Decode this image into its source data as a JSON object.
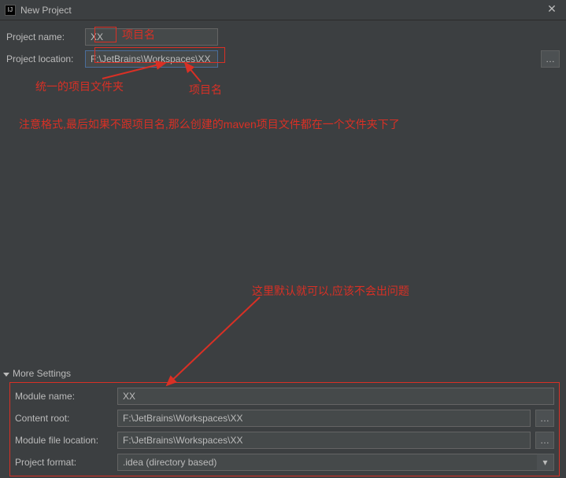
{
  "window": {
    "title": "New Project"
  },
  "form": {
    "project_name_label": "Project name:",
    "project_name_value": "XX",
    "project_location_label": "Project location:",
    "project_location_value": "F:\\JetBrains\\Workspaces\\XX",
    "browse_dots": "…"
  },
  "annotations": {
    "name1": "项目名",
    "unified": "统一的项目文件夹",
    "name2": "项目名",
    "warning": "注意格式,最后如果不跟项目名,那么创建的maven项目文件都在一个文件夹下了",
    "default_ok": "这里默认就可以,应该不会出问题"
  },
  "more": {
    "header": "More Settings",
    "module_name_label": "Module name:",
    "module_name_value": "XX",
    "content_root_label": "Content root:",
    "content_root_value": "F:\\JetBrains\\Workspaces\\XX",
    "module_file_loc_label": "Module file location:",
    "module_file_loc_value": "F:\\JetBrains\\Workspaces\\XX",
    "project_format_label": "Project format:",
    "project_format_value": ".idea (directory based)",
    "arrow_down": "▾"
  }
}
